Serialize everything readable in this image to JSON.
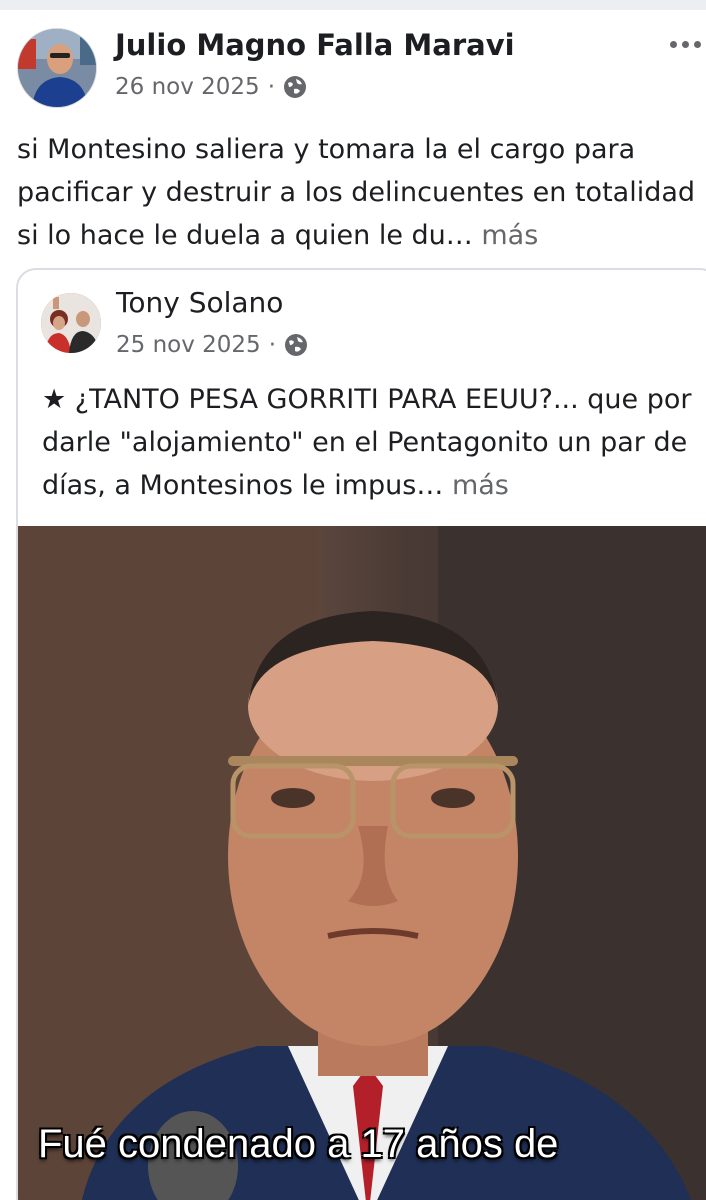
{
  "post": {
    "author": "Julio Magno Falla Maravi",
    "date": "26 nov 2025",
    "separator": "·",
    "audience_icon": "globe-icon",
    "text": "si Montesino saliera y tomara la el cargo para pacificar y destruir a los delincuentes en totalidad si lo hace le duela a quien le du…",
    "see_more": "más",
    "more_icon": "more-options-icon"
  },
  "shared_post": {
    "author": "Tony Solano",
    "date": "25 nov 2025",
    "separator": "·",
    "audience_icon": "globe-icon",
    "text": "★ ¿TANTO PESA GORRITI PARA EEUU?... que por darle \"alojamiento\" en el Pentagonito un par de días, a Montesinos le impus…",
    "see_more": "más",
    "image": {
      "caption": "Fué condenado a 17 años de"
    }
  },
  "colors": {
    "text_primary": "#1c1e21",
    "text_secondary": "#65676b",
    "border": "#dadde1"
  }
}
